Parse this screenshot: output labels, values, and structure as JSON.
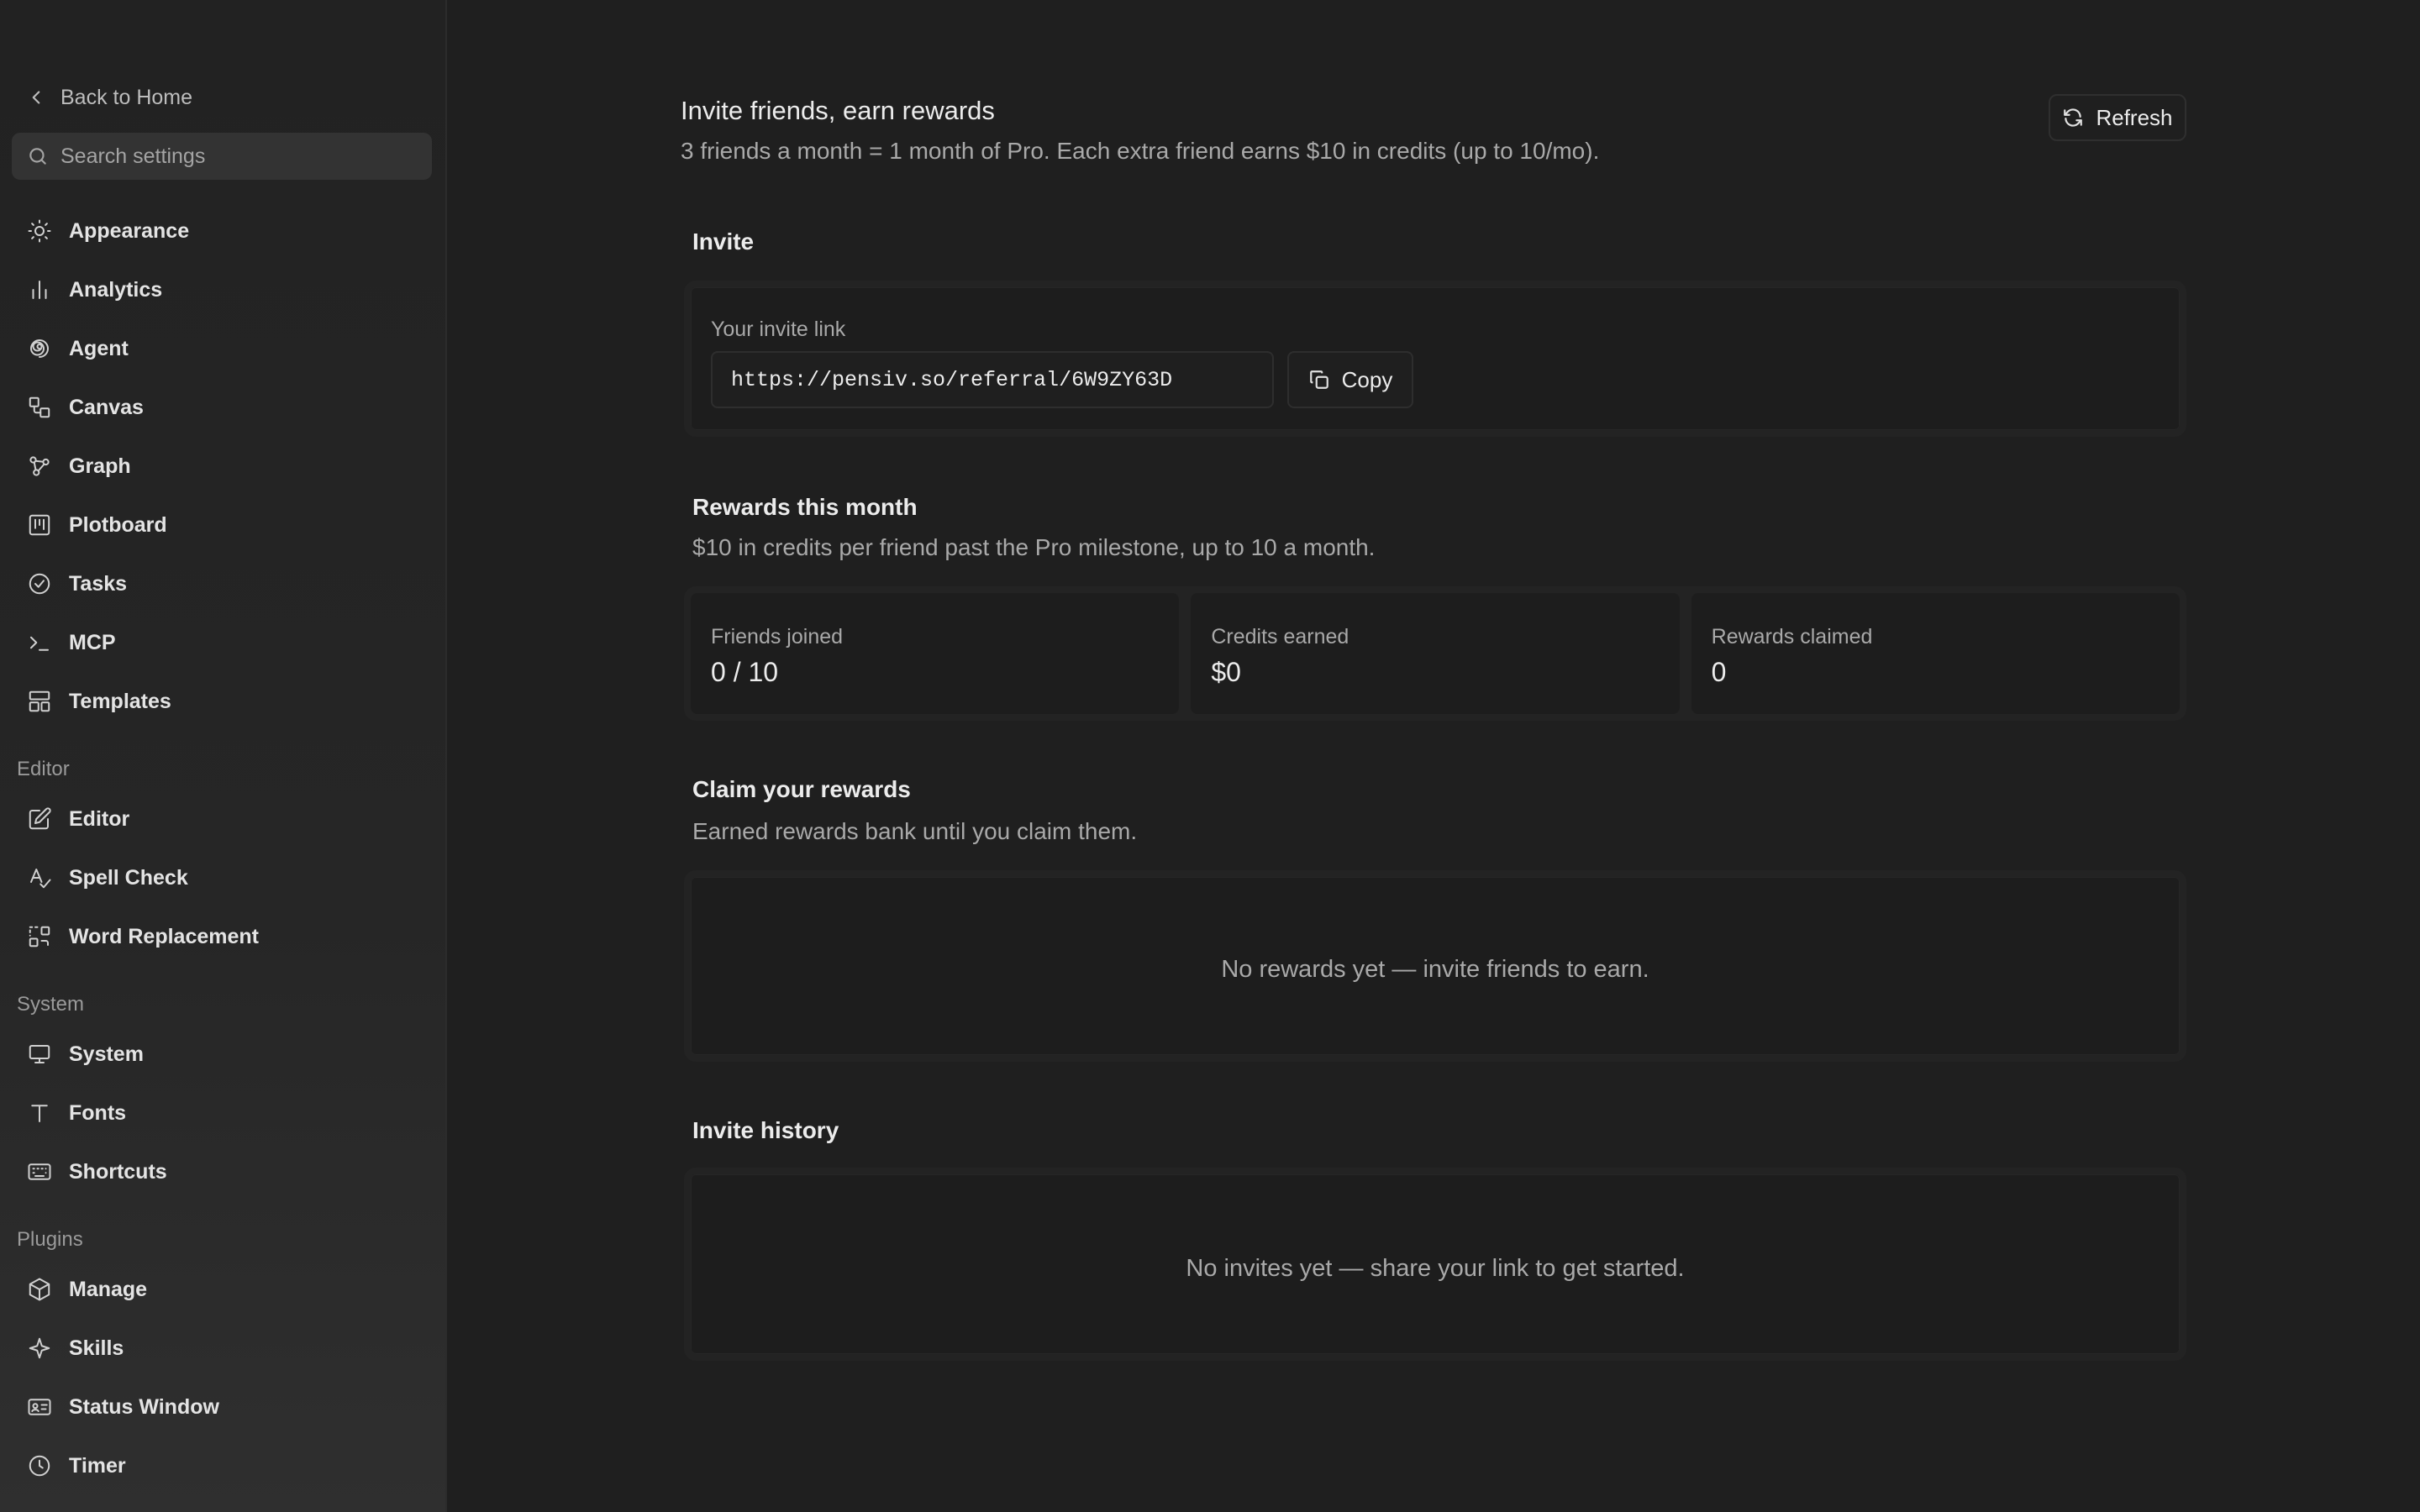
{
  "sidebar": {
    "back_label": "Back to Home",
    "search_placeholder": "Search settings",
    "items": [
      {
        "label": "Appearance",
        "icon": "sun-icon"
      },
      {
        "label": "Analytics",
        "icon": "bar-chart-icon"
      },
      {
        "label": "Agent",
        "icon": "spiral-icon"
      },
      {
        "label": "Canvas",
        "icon": "canvas-shapes-icon"
      },
      {
        "label": "Graph",
        "icon": "graph-nodes-icon"
      },
      {
        "label": "Plotboard",
        "icon": "plotboard-icon"
      },
      {
        "label": "Tasks",
        "icon": "check-circle-icon"
      },
      {
        "label": "MCP",
        "icon": "terminal-icon"
      },
      {
        "label": "Templates",
        "icon": "layout-template-icon"
      }
    ],
    "sections": {
      "editor": {
        "title": "Editor",
        "items": [
          {
            "label": "Editor",
            "icon": "pencil-square-icon"
          },
          {
            "label": "Spell Check",
            "icon": "spell-check-icon"
          },
          {
            "label": "Word Replacement",
            "icon": "replace-icon"
          }
        ]
      },
      "system": {
        "title": "System",
        "items": [
          {
            "label": "System",
            "icon": "monitor-icon"
          },
          {
            "label": "Fonts",
            "icon": "type-icon"
          },
          {
            "label": "Shortcuts",
            "icon": "keyboard-icon"
          }
        ]
      },
      "plugins": {
        "title": "Plugins",
        "items": [
          {
            "label": "Manage",
            "icon": "package-icon"
          },
          {
            "label": "Skills",
            "icon": "sparkle-icon"
          },
          {
            "label": "Status Window",
            "icon": "id-card-icon"
          },
          {
            "label": "Timer",
            "icon": "clock-icon"
          }
        ]
      }
    }
  },
  "main": {
    "title": "Invite friends, earn rewards",
    "subtitle": "3 friends a month = 1 month of Pro. Each extra friend earns $10 in credits (up to 10/mo).",
    "refresh_label": "Refresh",
    "invite": {
      "title": "Invite",
      "link_label": "Your invite link",
      "link_value": "https://pensiv.so/referral/6W9ZY63D",
      "copy_label": "Copy"
    },
    "rewards": {
      "title": "Rewards this month",
      "description": "$10 in credits per friend past the Pro milestone, up to 10 a month.",
      "stats": [
        {
          "label": "Friends joined",
          "value": "0 / 10"
        },
        {
          "label": "Credits earned",
          "value": "$0"
        },
        {
          "label": "Rewards claimed",
          "value": "0"
        }
      ]
    },
    "claim": {
      "title": "Claim your rewards",
      "description": "Earned rewards bank until you claim them.",
      "empty": "No rewards yet — invite friends to earn."
    },
    "history": {
      "title": "Invite history",
      "empty": "No invites yet — share your link to get started."
    }
  }
}
